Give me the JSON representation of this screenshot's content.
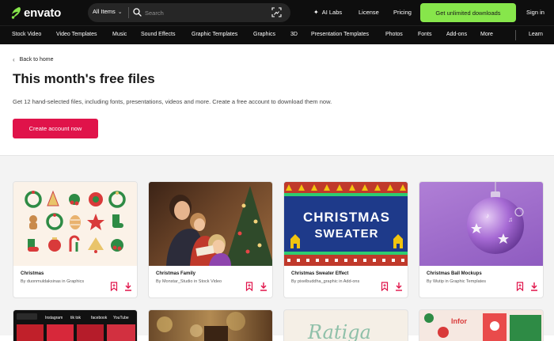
{
  "header": {
    "logo_text": "envato",
    "search_category": "All Items",
    "search_placeholder": "Search",
    "ai_labs": "AI Labs",
    "license": "License",
    "pricing": "Pricing",
    "cta": "Get unlimited downloads",
    "sign_in": "Sign in"
  },
  "nav": {
    "items": [
      "Stock Video",
      "Video Templates",
      "Music",
      "Sound Effects",
      "Graphic Templates",
      "Graphics",
      "3D",
      "Presentation Templates",
      "Photos",
      "Fonts",
      "Add-ons",
      "More"
    ],
    "learn": "Learn"
  },
  "hero": {
    "back": "Back to home",
    "title": "This month's free files",
    "subtitle": "Get 12 hand-selected files, including fonts, presentations, videos and more. Create a free account to download them now.",
    "cta": "Create account now"
  },
  "cards": [
    {
      "title": "Christmas",
      "author": "By duonmuldaksinas in Graphics"
    },
    {
      "title": "Christmas Family",
      "author": "By Monstar_Studio in Stock Video"
    },
    {
      "title": "Christmas Sweater Effect",
      "author": "By pixelbuddha_graphic in Add-ons"
    },
    {
      "title": "Christmas Ball Mockups",
      "author": "By Wutip in Graphic Templates"
    }
  ],
  "thumb_texts": {
    "sweater_line1": "CHRISTMAS",
    "sweater_line2": "SWEATER",
    "social": [
      "Instagram",
      "tik tok",
      "facebook",
      "YouTube"
    ],
    "script": "Ratiga",
    "infor": "Infor"
  },
  "colors": {
    "accent_green": "#87e64b",
    "accent_red": "#e0134a",
    "bar": "#0e0e0e"
  }
}
